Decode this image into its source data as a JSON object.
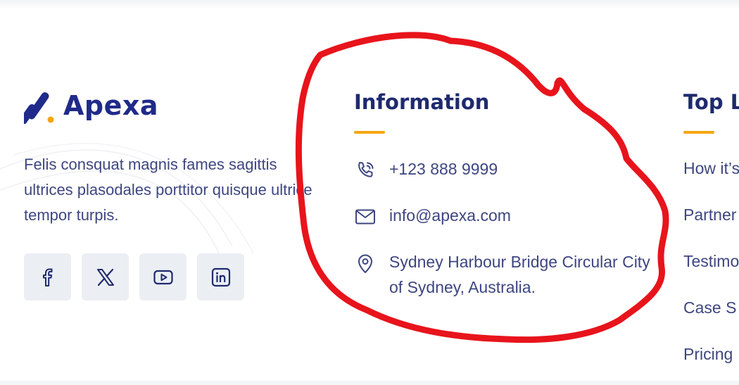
{
  "brand": {
    "name": "Apexa",
    "colors": {
      "primary": "#1f2a8a",
      "accent": "#f5a60d"
    }
  },
  "about": {
    "text": "Felis consquat magnis fames sagittis ultrices plasodales porttitor quisque ultrice tempor turpis."
  },
  "socials": [
    {
      "icon": "facebook-icon"
    },
    {
      "icon": "x-twitter-icon"
    },
    {
      "icon": "youtube-icon"
    },
    {
      "icon": "linkedin-icon"
    }
  ],
  "information": {
    "title": "Information",
    "phone": "+123 888 9999",
    "email": "info@apexa.com",
    "address": "Sydney Harbour Bridge Circular City of Sydney, Australia."
  },
  "top_links": {
    "title": "Top L",
    "items": [
      "How it’s",
      "Partner",
      "Testimo",
      "Case S",
      "Pricing"
    ]
  },
  "annotation": {
    "color": "#e8141c",
    "shape": "hand-drawn circle around Information column"
  }
}
